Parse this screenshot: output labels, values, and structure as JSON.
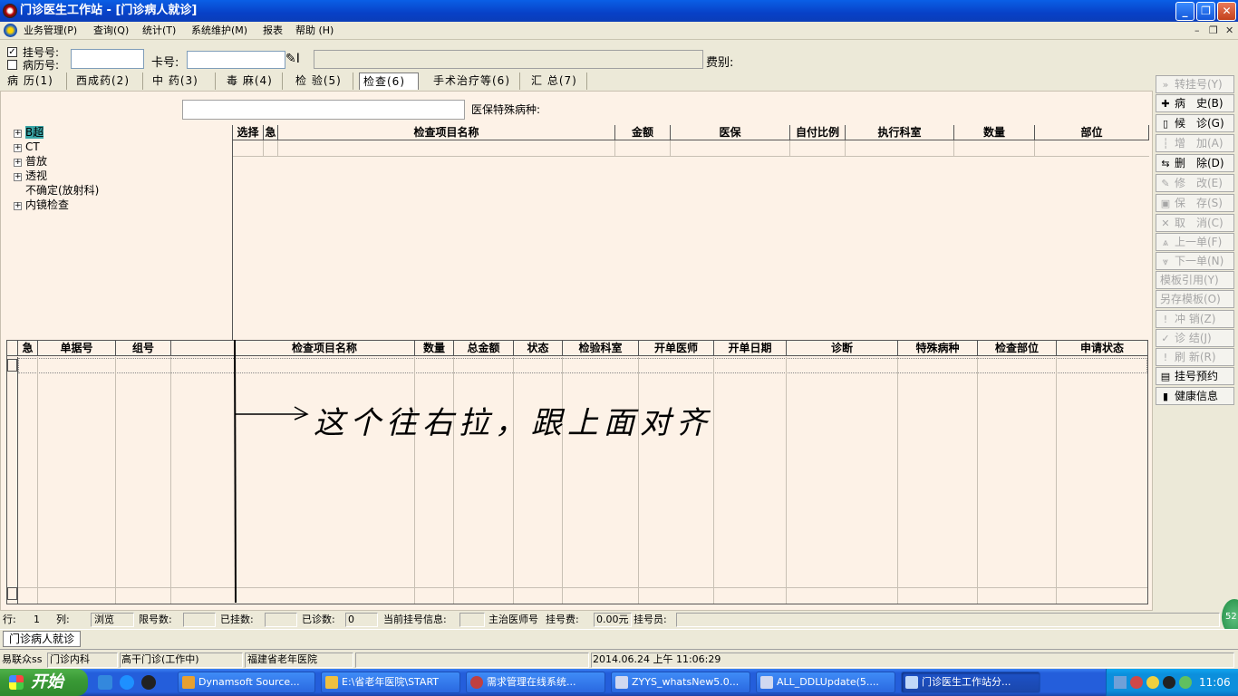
{
  "window": {
    "title": "门诊医生工作站 - [门诊病人就诊]"
  },
  "menu": [
    "业务管理(P)",
    "查询(Q)",
    "统计(T)",
    "系统维护(M)",
    "报表",
    "帮助 (H)"
  ],
  "form": {
    "reg_label": "挂号号:",
    "record_label": "病历号:",
    "card_label": "卡号:",
    "fee_type_label": "费别:",
    "special_disease_label": "医保特殊病种:",
    "card_btn_suffix": "I"
  },
  "tabs": [
    "病 历(1)",
    "西成药(2)",
    "中 药(3)",
    "毒 麻(4)",
    "检 验(5)",
    "检查(6)",
    "手术治疗等(6)",
    "汇 总(7)"
  ],
  "tree": [
    "B超",
    "CT",
    "普放",
    "透视",
    "不确定(放射科)",
    "内镜检查"
  ],
  "upper_grid": {
    "headers": [
      "选择",
      "急",
      "检查项目名称",
      "金额",
      "医保",
      "自付比例",
      "执行科室",
      "数量",
      "部位"
    ]
  },
  "lower_grid": {
    "headers": [
      "急",
      "单据号",
      "组号",
      "",
      "检查项目名称",
      "数量",
      "总金额",
      "状态",
      "检验科室",
      "开单医师",
      "开单日期",
      "诊断",
      "特殊病种",
      "检查部位",
      "申请状态"
    ]
  },
  "annotation": {
    "text": "这个往右拉，跟上面对齐"
  },
  "buttons": [
    {
      "label": "转挂号(Y)",
      "icon": "double-chevron-right-icon",
      "glyph": "»",
      "enabled": false
    },
    {
      "label": "病　史(B)",
      "icon": "plus-icon",
      "glyph": "✚",
      "enabled": true
    },
    {
      "label": "候　诊(G)",
      "icon": "document-icon",
      "glyph": "▯",
      "enabled": true
    },
    {
      "label": "增　加(A)",
      "icon": "add-icon",
      "glyph": "┆",
      "enabled": false
    },
    {
      "label": "删　除(D)",
      "icon": "delete-icon",
      "glyph": "⇆",
      "enabled": true
    },
    {
      "label": "修　改(E)",
      "icon": "edit-icon",
      "glyph": "✎",
      "enabled": false
    },
    {
      "label": "保　存(S)",
      "icon": "save-icon",
      "glyph": "▣",
      "enabled": false
    },
    {
      "label": "取　消(C)",
      "icon": "cancel-icon",
      "glyph": "✕",
      "enabled": false
    },
    {
      "label": "上一单(F)",
      "icon": "up-icon",
      "glyph": "⩓",
      "enabled": false
    },
    {
      "label": "下一单(N)",
      "icon": "down-icon",
      "glyph": "⩔",
      "enabled": false
    },
    {
      "label": "模板引用(Y)",
      "icon": "",
      "glyph": "",
      "enabled": false
    },
    {
      "label": "另存模板(O)",
      "icon": "",
      "glyph": "",
      "enabled": false
    },
    {
      "label": "冲 销(Z)",
      "icon": "alert-icon",
      "glyph": "!",
      "enabled": false
    },
    {
      "label": "诊 结(J)",
      "icon": "check-icon",
      "glyph": "✓",
      "enabled": false
    },
    {
      "label": "刷 新(R)",
      "icon": "refresh-icon",
      "glyph": "!",
      "enabled": false
    },
    {
      "label": "挂号预约",
      "icon": "book-icon",
      "glyph": "▤",
      "enabled": true
    },
    {
      "label": "健康信息",
      "icon": "health-card-icon",
      "glyph": "▮",
      "enabled": true
    }
  ],
  "status": {
    "row_label": "行:",
    "row_val": "1",
    "col_label": "列:",
    "mode": "浏览",
    "limit_label": "限号数:",
    "registered_label": "已挂数:",
    "seen_label": "已诊数:",
    "seen_val": "0",
    "current_reg_label": "当前挂号信息:",
    "doctor_label": "主治医师号",
    "fee_label": "挂号费:",
    "fee_val": "0.00元",
    "clerk_label": "挂号员:"
  },
  "mdi_tab": "门诊病人就诊",
  "footer": {
    "user": "易联众ss",
    "dept": "门诊内科",
    "clinic": "高干门诊(工作中)",
    "hospital": "福建省老年医院",
    "datetime": "2014.06.24 上午 11:06:29"
  },
  "floating_badge": "52",
  "taskbar": {
    "start": "开始",
    "items": [
      "Dynamsoft Source...",
      "E:\\省老年医院\\START",
      "需求管理在线系统...",
      "ZYYS_whatsNew5.0...",
      "ALL_DDLUpdate(5....",
      "门诊医生工作站分..."
    ],
    "clock": "11:06"
  }
}
